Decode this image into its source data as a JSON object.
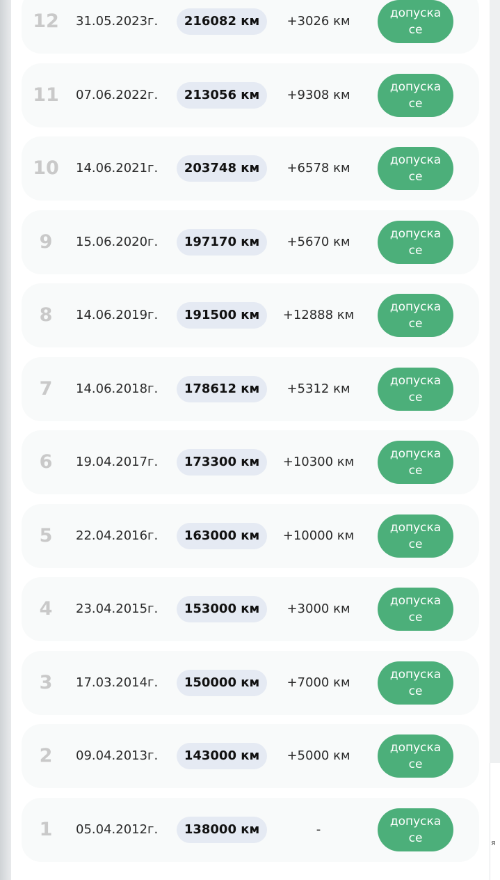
{
  "unit": "км",
  "status_label": "допуска се",
  "rows": [
    {
      "n": "12",
      "date": "31.05.2023г.",
      "km": "216082 км",
      "diff": "+3026 км",
      "status": "допуска се"
    },
    {
      "n": "11",
      "date": "07.06.2022г.",
      "km": "213056 км",
      "diff": "+9308 км",
      "status": "допуска се"
    },
    {
      "n": "10",
      "date": "14.06.2021г.",
      "km": "203748 км",
      "diff": "+6578 км",
      "status": "допуска се"
    },
    {
      "n": "9",
      "date": "15.06.2020г.",
      "km": "197170 км",
      "diff": "+5670 км",
      "status": "допуска се"
    },
    {
      "n": "8",
      "date": "14.06.2019г.",
      "km": "191500 км",
      "diff": "+12888 км",
      "status": "допуска се"
    },
    {
      "n": "7",
      "date": "14.06.2018г.",
      "km": "178612 км",
      "diff": "+5312 км",
      "status": "допуска се"
    },
    {
      "n": "6",
      "date": "19.04.2017г.",
      "km": "173300 км",
      "diff": "+10300 км",
      "status": "допуска се"
    },
    {
      "n": "5",
      "date": "22.04.2016г.",
      "km": "163000 км",
      "diff": "+10000 км",
      "status": "допуска се"
    },
    {
      "n": "4",
      "date": "23.04.2015г.",
      "km": "153000 км",
      "diff": "+3000 км",
      "status": "допуска се"
    },
    {
      "n": "3",
      "date": "17.03.2014г.",
      "km": "150000 км",
      "diff": "+7000 км",
      "status": "допуска се"
    },
    {
      "n": "2",
      "date": "09.04.2013г.",
      "km": "143000 км",
      "diff": "+5000 км",
      "status": "допуска се"
    },
    {
      "n": "1",
      "date": "05.04.2012г.",
      "km": "138000 км",
      "diff": "-",
      "status": "допуска се"
    }
  ],
  "background_fragment": "я",
  "colors": {
    "status_green": "#4caf7a",
    "badge_bg": "#e5eaf3",
    "row_bg": "#f8fafa",
    "number_gray": "#c9c9c9"
  }
}
